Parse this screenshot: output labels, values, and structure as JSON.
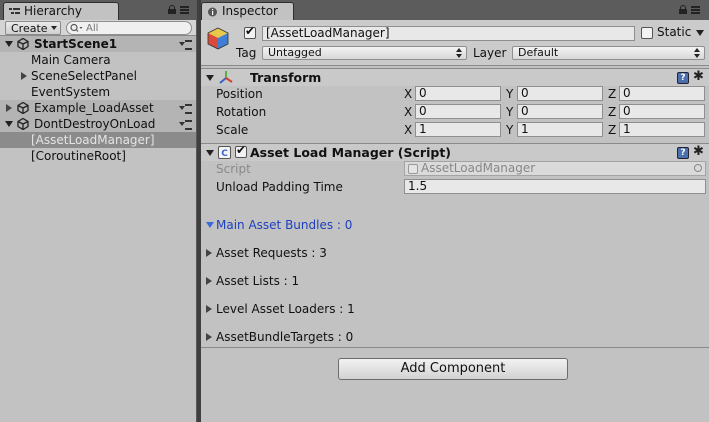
{
  "hierarchy": {
    "tab_label": "Hierarchy",
    "create_label": "Create",
    "search_placeholder": "All",
    "items": [
      {
        "label": "StartScene1",
        "kind": "scene",
        "expanded": true
      },
      {
        "label": "Main Camera",
        "kind": "object"
      },
      {
        "label": "SceneSelectPanel",
        "kind": "object",
        "collapsed": true
      },
      {
        "label": "EventSystem",
        "kind": "object"
      },
      {
        "label": "Example_LoadAsset",
        "kind": "scene",
        "expanded": false
      },
      {
        "label": "DontDestroyOnLoad",
        "kind": "scene",
        "expanded": true
      },
      {
        "label": "[AssetLoadManager]",
        "kind": "object",
        "selected": true
      },
      {
        "label": "[CoroutineRoot]",
        "kind": "object"
      }
    ]
  },
  "inspector": {
    "tab_label": "Inspector",
    "object_name": "[AssetLoadManager]",
    "static_label": "Static",
    "tag_label": "Tag",
    "tag_value": "Untagged",
    "layer_label": "Layer",
    "layer_value": "Default",
    "transform": {
      "title": "Transform",
      "rows": [
        {
          "label": "Position",
          "x": "0",
          "y": "0",
          "z": "0"
        },
        {
          "label": "Rotation",
          "x": "0",
          "y": "0",
          "z": "0"
        },
        {
          "label": "Scale",
          "x": "1",
          "y": "1",
          "z": "1"
        }
      ],
      "axes": [
        "X",
        "Y",
        "Z"
      ]
    },
    "script_component": {
      "title": "Asset Load Manager (Script)",
      "script_label": "Script",
      "script_value": "AssetLoadManager",
      "padding_label": "Unload Padding Time",
      "padding_value": "1.5"
    },
    "foldouts": [
      {
        "label": "Main Asset Bundles : 0",
        "expanded": true
      },
      {
        "label": "Asset Requests : 3",
        "expanded": false
      },
      {
        "label": "Asset Lists : 1",
        "expanded": false
      },
      {
        "label": "Level Asset Loaders : 1",
        "expanded": false
      },
      {
        "label": "AssetBundleTargets : 0",
        "expanded": false
      }
    ],
    "add_component_label": "Add Component"
  },
  "colors": {
    "panel_bg": "#c2c2c2",
    "selection_bg": "#8b8b8b",
    "foldout_blue": "#1d3fbe"
  }
}
